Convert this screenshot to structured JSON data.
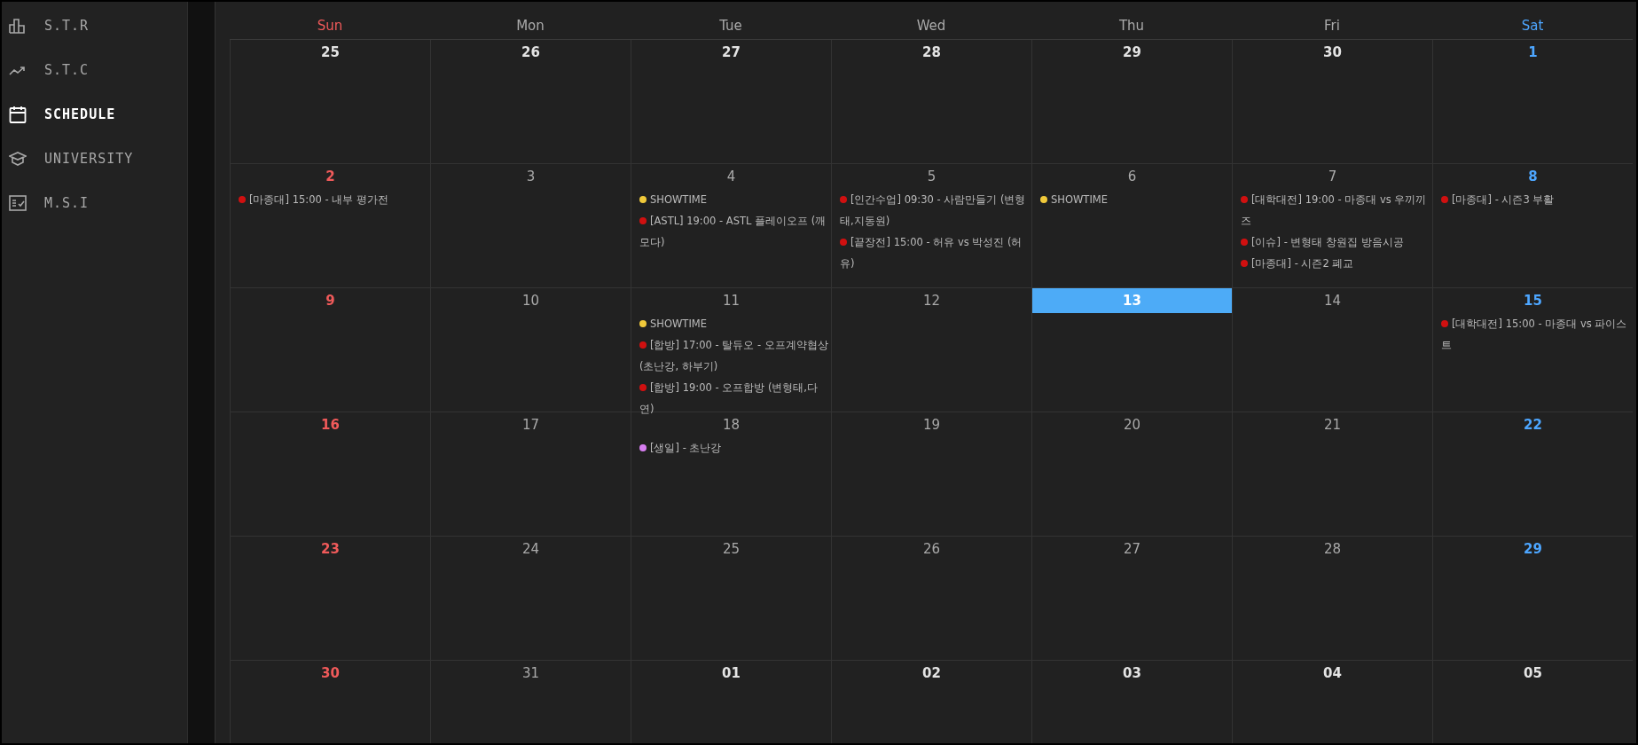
{
  "sidebar": {
    "items": [
      {
        "label": "S.T.R",
        "selected": false
      },
      {
        "label": "S.T.C",
        "selected": false
      },
      {
        "label": "SCHEDULE",
        "selected": true
      },
      {
        "label": "UNIVERSITY",
        "selected": false
      },
      {
        "label": "M.S.I",
        "selected": false
      }
    ]
  },
  "calendar": {
    "weekdays": [
      "Sun",
      "Mon",
      "Tue",
      "Wed",
      "Thu",
      "Fri",
      "Sat"
    ],
    "weeks": [
      [
        {
          "date": "25",
          "in_month": false,
          "today": false
        },
        {
          "date": "26",
          "in_month": false,
          "today": false
        },
        {
          "date": "27",
          "in_month": false,
          "today": false
        },
        {
          "date": "28",
          "in_month": false,
          "today": false
        },
        {
          "date": "29",
          "in_month": false,
          "today": false
        },
        {
          "date": "30",
          "in_month": false,
          "today": false
        },
        {
          "date": "1",
          "in_month": true,
          "today": false
        }
      ],
      [
        {
          "date": "2",
          "in_month": true,
          "today": false,
          "events": [
            {
              "text": "[마종대] 15:00 - 내부 평가전",
              "color": "#d01010"
            }
          ]
        },
        {
          "date": "3",
          "in_month": true,
          "today": false
        },
        {
          "date": "4",
          "in_month": true,
          "today": false,
          "events": [
            {
              "text": "SHOWTIME",
              "color": "#f0c93a"
            },
            {
              "text": "[ASTL] 19:00 - ASTL 플레이오프 (깨모다)",
              "color": "#d01010"
            }
          ]
        },
        {
          "date": "5",
          "in_month": true,
          "today": false,
          "events": [
            {
              "text": "[인간수업] 09:30 - 사람만들기 (변형태,지동원)",
              "color": "#d01010"
            },
            {
              "text": "[끝장전] 15:00 - 허유 vs 박성진 (허유)",
              "color": "#d01010"
            }
          ]
        },
        {
          "date": "6",
          "in_month": true,
          "today": false,
          "events": [
            {
              "text": "SHOWTIME",
              "color": "#f0c93a"
            }
          ]
        },
        {
          "date": "7",
          "in_month": true,
          "today": false,
          "events": [
            {
              "text": "[대학대전] 19:00 - 마종대 vs 우끼끼즈",
              "color": "#d01010"
            },
            {
              "text": "[이슈] - 변형태 창원집 방음시공",
              "color": "#d01010"
            },
            {
              "text": "[마종대] - 시즌2 폐교",
              "color": "#d01010"
            }
          ]
        },
        {
          "date": "8",
          "in_month": true,
          "today": false,
          "events": [
            {
              "text": "[마종대] - 시즌3 부활",
              "color": "#d01010"
            }
          ]
        }
      ],
      [
        {
          "date": "9",
          "in_month": true,
          "today": false
        },
        {
          "date": "10",
          "in_month": true,
          "today": false
        },
        {
          "date": "11",
          "in_month": true,
          "today": false,
          "events": [
            {
              "text": "SHOWTIME",
              "color": "#f0c93a"
            },
            {
              "text": "[합방] 17:00 - 탈듀오 - 오프계약협상 (초난강, 하부기)",
              "color": "#d01010"
            },
            {
              "text": "[합방] 19:00 - 오프합방 (변형태,다연)",
              "color": "#d01010"
            }
          ]
        },
        {
          "date": "12",
          "in_month": true,
          "today": false
        },
        {
          "date": "13",
          "in_month": true,
          "today": true
        },
        {
          "date": "14",
          "in_month": true,
          "today": false
        },
        {
          "date": "15",
          "in_month": true,
          "today": false,
          "events": [
            {
              "text": "[대학대전] 15:00 - 마종대 vs 파이스트",
              "color": "#d01010"
            }
          ]
        }
      ],
      [
        {
          "date": "16",
          "in_month": true,
          "today": false
        },
        {
          "date": "17",
          "in_month": true,
          "today": false
        },
        {
          "date": "18",
          "in_month": true,
          "today": false,
          "events": [
            {
              "text": "[생일] - 초난강",
              "color": "#d77ef0"
            }
          ]
        },
        {
          "date": "19",
          "in_month": true,
          "today": false
        },
        {
          "date": "20",
          "in_month": true,
          "today": false
        },
        {
          "date": "21",
          "in_month": true,
          "today": false
        },
        {
          "date": "22",
          "in_month": true,
          "today": false
        }
      ],
      [
        {
          "date": "23",
          "in_month": true,
          "today": false
        },
        {
          "date": "24",
          "in_month": true,
          "today": false
        },
        {
          "date": "25",
          "in_month": true,
          "today": false
        },
        {
          "date": "26",
          "in_month": true,
          "today": false
        },
        {
          "date": "27",
          "in_month": true,
          "today": false
        },
        {
          "date": "28",
          "in_month": true,
          "today": false
        },
        {
          "date": "29",
          "in_month": true,
          "today": false
        }
      ],
      [
        {
          "date": "30",
          "in_month": true,
          "today": false
        },
        {
          "date": "31",
          "in_month": true,
          "today": false
        },
        {
          "date": "01",
          "in_month": false,
          "today": false
        },
        {
          "date": "02",
          "in_month": false,
          "today": false
        },
        {
          "date": "03",
          "in_month": false,
          "today": false
        },
        {
          "date": "04",
          "in_month": false,
          "today": false
        },
        {
          "date": "05",
          "in_month": false,
          "today": false
        }
      ]
    ]
  }
}
